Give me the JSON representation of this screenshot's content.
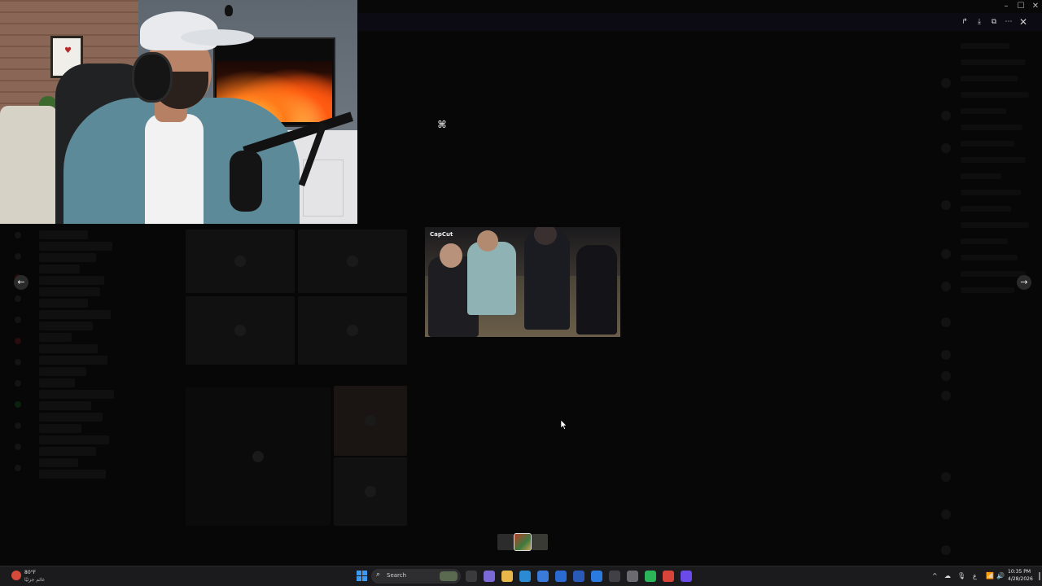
{
  "window": {
    "title": "",
    "controls": {
      "minimize": "–",
      "maximize": "☐",
      "close": "✕"
    }
  },
  "viewer": {
    "actions": {
      "forward": "↱",
      "download": "⤓",
      "open_external": "⧉",
      "more": "⋯",
      "close": "✕"
    },
    "logo_glyph": "⌘",
    "media_watermark": "CapCut",
    "nav_prev": "←",
    "nav_next": "→",
    "thumbnails": [
      "",
      "",
      ""
    ],
    "selected_thumbnail": 1
  },
  "taskbar": {
    "weather": {
      "temp": "80°F",
      "condition": "غائم جزئيًا"
    },
    "search_placeholder": "Search",
    "search_icon": "⌕",
    "apps": [
      {
        "name": "task-view-icon",
        "color": "#3a3a3c"
      },
      {
        "name": "copilot-icon",
        "color": "#7a6ad8"
      },
      {
        "name": "file-explorer-icon",
        "color": "#e8b84a"
      },
      {
        "name": "edge-icon",
        "color": "#2a8ad4"
      },
      {
        "name": "store-icon",
        "color": "#3a7ad8"
      },
      {
        "name": "shield-icon",
        "color": "#2b6ad0"
      },
      {
        "name": "calendar-icon",
        "color": "#2a5ab8"
      },
      {
        "name": "mail-icon",
        "color": "#2a7ae0"
      },
      {
        "name": "media-icon",
        "color": "#404046"
      },
      {
        "name": "settings-icon",
        "color": "#6a6a70"
      },
      {
        "name": "green-app-icon",
        "color": "#2cb45a"
      },
      {
        "name": "chrome-icon",
        "color": "#d8443a"
      },
      {
        "name": "messenger-icon",
        "color": "#6a4ae8"
      }
    ],
    "tray": {
      "chevron": "^",
      "cloud": "☁",
      "mic": "🎙",
      "lang": "ع",
      "wifi": "📶",
      "volume": "🔊",
      "battery": "▭"
    },
    "time": "10:35 PM",
    "date": "4/28/2026"
  },
  "colors": {
    "accent": "#3d9af0",
    "taskbar_bg": "#1b1b1d",
    "overlay_bg": "#030303"
  }
}
